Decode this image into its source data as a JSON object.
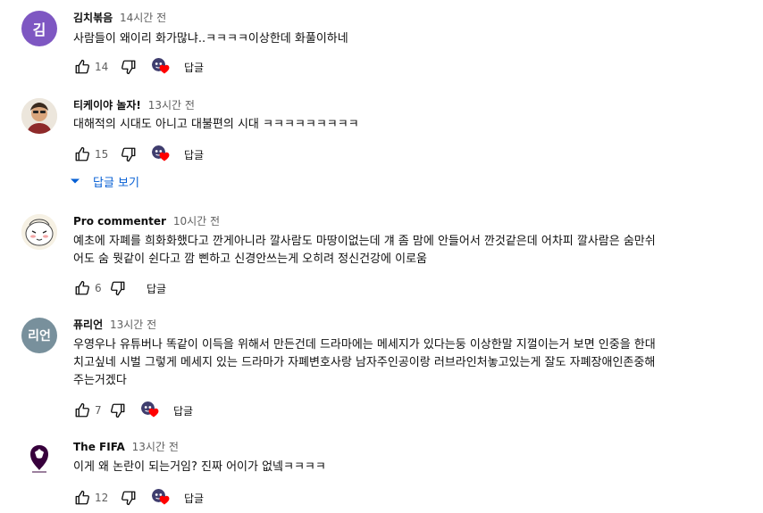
{
  "comments": [
    {
      "avatar_letter": "김",
      "avatar_color": "#7e57c2",
      "author": "김치볶음",
      "time": "14시간 전",
      "text_lines": [
        "사람들이 왜이리 화가많냐..ㅋㅋㅋㅋ이상한데 화풀이하네"
      ],
      "likes": "14",
      "hearted": true,
      "reply_label": "답글"
    },
    {
      "avatar_letter": "",
      "avatar_color": "#e9e2d6",
      "author": "티케이야 놀자!",
      "time": "13시간 전",
      "text_lines": [
        "대해적의 시대도 아니고 대불편의 시대 ㅋㅋㅋㅋㅋㅋㅋㅋㅋ"
      ],
      "likes": "15",
      "hearted": true,
      "reply_label": "답글"
    },
    {
      "avatar_letter": "",
      "avatar_color": "#f4efe2",
      "author": "Pro commenter",
      "time": "10시간 전",
      "text_lines": [
        "예초에 자폐를 희화화했다고 깐게아니라 깔사람도 마땅이없는데 걔 좀 맘에 안들어서 깐것같은데 어차피 깔사람은 숨만쉬",
        "어도 숨 뭣같이 쉰다고 깜  삔하고 신경안쓰는게 오히려 정신건강에 이로움"
      ],
      "likes": "6",
      "hearted": false,
      "reply_label": "답글"
    },
    {
      "avatar_letter": "리언",
      "avatar_color": "#78909c",
      "author": "퓨리언",
      "time": "13시간 전",
      "text_lines": [
        "우영우나 유튜버나 똑같이 이득을 위해서 만든건데 드라마에는 메세지가 있다는둥 이상한말 지껄이는거 보면 인중을 한대",
        "치고싶네 시벌 그렇게  메세지 있는 드라마가 자폐변호사랑 남자주인공이랑 러브라인처놓고있는게 잘도 자폐장애인존중해",
        "주는거겠다"
      ],
      "likes": "7",
      "hearted": true,
      "reply_label": "답글"
    },
    {
      "avatar_letter": "",
      "avatar_color": "#ffffff",
      "author": "The FIFA",
      "time": "13시간 전",
      "text_lines": [
        "이게 왜 논란이 되는거임? 진짜 어이가 없넼ㅋㅋㅋㅋ"
      ],
      "likes": "12",
      "hearted": true,
      "reply_label": "답글"
    }
  ],
  "view_replies_label": "답글 보기",
  "colors": {
    "link": "#065fd4",
    "heart": "#ff0000",
    "secondary_text": "#606060"
  },
  "icons": [
    "like-icon",
    "dislike-icon",
    "creator-heart-icon",
    "chevron-down-icon"
  ]
}
